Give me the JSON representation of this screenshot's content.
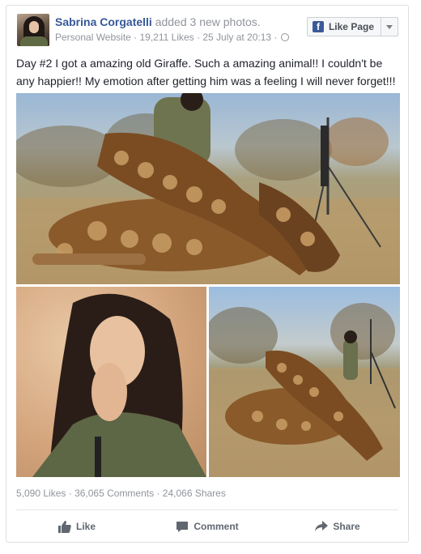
{
  "post": {
    "author_name": "Sabrina Corgatelli",
    "action_text": "added 3 new photos.",
    "meta": {
      "category": "Personal Website",
      "likes": "19,211 Likes",
      "date": "25 July at 20:13",
      "separator": " · "
    },
    "like_page_label": "Like Page",
    "text": "Day #2 I got a amazing old Giraffe. Such a amazing animal!! I couldn't be any happier!! My emotion after getting him was a feeling I will never forget!!!"
  },
  "stats": {
    "likes": "5,090 Likes",
    "comments": "36,065 Comments",
    "shares": "24,066 Shares",
    "separator": " · "
  },
  "actions": {
    "like": "Like",
    "comment": "Comment",
    "share": "Share"
  },
  "icons": {
    "page_avatar": "avatar-photo",
    "like_page": "facebook-f-icon",
    "dropdown": "chevron-down-icon",
    "privacy": "globe-icon",
    "like": "thumbs-up-icon",
    "comment": "comment-bubble-icon",
    "share": "share-arrow-icon"
  },
  "colors": {
    "link_blue": "#365899",
    "fb_blue": "#3b5998",
    "meta_gray": "#90949c",
    "text": "#1d2129",
    "action_gray": "#606770",
    "border": "#dddfe2"
  }
}
